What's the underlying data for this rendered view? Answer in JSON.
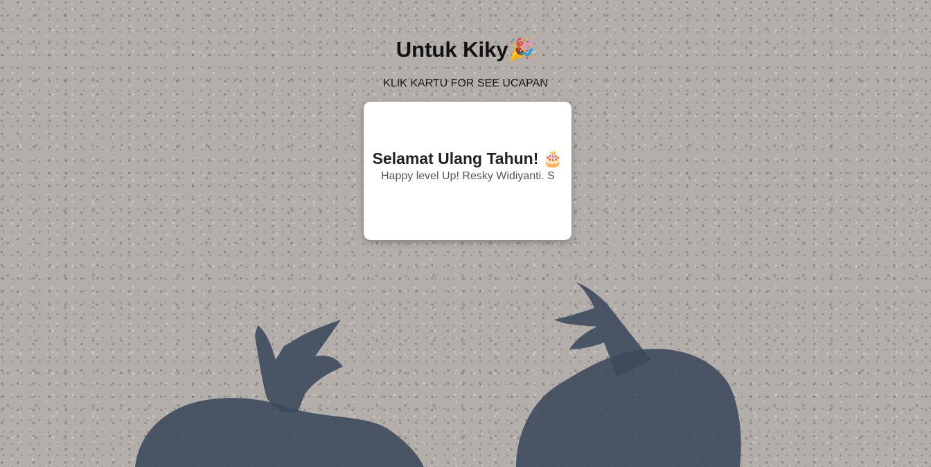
{
  "header": {
    "title": "Untuk Kiky🎉",
    "subtitle": "KLIK KARTU FOR SEE UCAPAN"
  },
  "card": {
    "title": "Selamat Ulang Tahun! 🎂",
    "message": "Happy level Up! Resky Widiyanti. S"
  },
  "colors": {
    "background": "#b3aeaa",
    "card": "#ffffff",
    "shadow": "#3d4a5c"
  }
}
